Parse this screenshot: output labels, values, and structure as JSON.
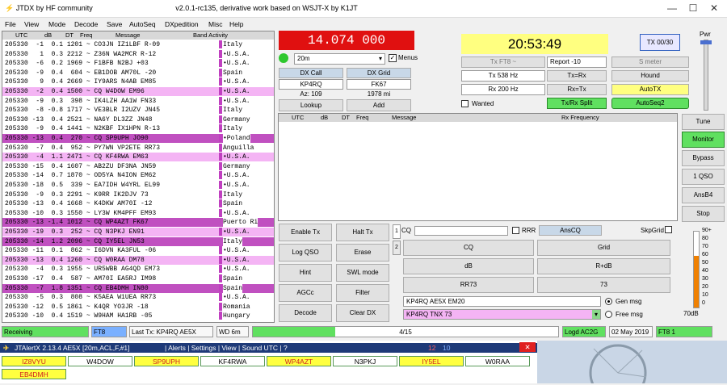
{
  "window": {
    "app_title": "JTDX  by HF community",
    "subtitle": "v2.0.1-rc135, derivative work based on WSJT-X by K1JT"
  },
  "menu": [
    "File",
    "View",
    "Mode",
    "Decode",
    "Save",
    "AutoSeq",
    "DXpedition",
    "Misc",
    "Help"
  ],
  "band_activity": {
    "headers": {
      "utc": "UTC",
      "db": "dB",
      "dt": "DT",
      "freq": "Freq",
      "message": "Message",
      "title": "Band Activity"
    },
    "rows": [
      {
        "text": "205330  -1  0.1 1201 ~ CO3JN IZ1LBF R-09",
        "country": "Italy",
        "bg": "#ffffff",
        "mark": true
      },
      {
        "text": "205330   1  0.3 2212 ~ Z36N WA2MCR R-12",
        "country": "•U.S.A.",
        "bg": "#ffffff",
        "mark": true
      },
      {
        "text": "205330  -6  0.2 1969 ~ F1BFB N2BJ +03",
        "country": "•U.S.A.",
        "bg": "#ffffff",
        "mark": true
      },
      {
        "text": "205330  -9  0.4  604 ~ EB1DOB AM70L -20",
        "country": "Spain",
        "bg": "#ffffff",
        "mark": true
      },
      {
        "text": "205330   9  0.4 2669 ~ IY9ARS N4AB EM85",
        "country": "•U.S.A.",
        "bg": "#ffffff",
        "mark": true
      },
      {
        "text": "205330  -2  0.4 1500 ~ CQ W4DOW EM96",
        "country": "•U.S.A.",
        "bg": "#f4b4f4",
        "mark": true
      },
      {
        "text": "205330  -9  0.3  398 ~ IK4LZH AA1W FN33",
        "country": "•U.S.A.",
        "bg": "#ffffff",
        "mark": true
      },
      {
        "text": "205330  -8 -0.8 1717 ~ VE3BLR I2UZV JN45",
        "country": "Italy",
        "bg": "#ffffff",
        "mark": true
      },
      {
        "text": "205330 -13  0.4 2521 ~ NA6Y DL3ZZ JN48",
        "country": "Germany",
        "bg": "#ffffff",
        "mark": true
      },
      {
        "text": "205330  -9  0.4 1441 ~ N2KBF IX1HPN R-13",
        "country": "Italy",
        "bg": "#ffffff",
        "mark": true
      },
      {
        "text": "205330 -13  0.4  270 ~ CQ SP9UPH JO90",
        "country": "•Poland",
        "bg": "#c050c0",
        "mark": true
      },
      {
        "text": "205330  -7  0.4  952 ~ PY7WN VP2ETE RR73",
        "country": "Anguilla",
        "bg": "#ffffff",
        "mark": true
      },
      {
        "text": "205330  -4  1.1 2471 ~ CQ KF4RWA EM63",
        "country": "•U.S.A.",
        "bg": "#f4b4f4",
        "mark": true
      },
      {
        "text": "205330 -15  0.4 1607 ~ AB2ZU DF3NA JN59",
        "country": "Germany",
        "bg": "#ffffff",
        "mark": true
      },
      {
        "text": "205330 -14  0.7 1870 ~ OD5YA N4ION EM62",
        "country": "•U.S.A.",
        "bg": "#ffffff",
        "mark": true
      },
      {
        "text": "205330 -18  0.5  339 ~ EA7IDH W4YRL EL99",
        "country": "•U.S.A.",
        "bg": "#ffffff",
        "mark": true
      },
      {
        "text": "205330  -9  0.3 2291 ~ K9RR IK2DJV 73",
        "country": "Italy",
        "bg": "#ffffff",
        "mark": true
      },
      {
        "text": "205330 -13  0.4 1668 ~ K4DKW AM70I -12",
        "country": "Spain",
        "bg": "#ffffff",
        "mark": true
      },
      {
        "text": "205330 -10  0.3 1550 ~ LY3W KM4PFF EM93",
        "country": "•U.S.A.",
        "bg": "#ffffff",
        "mark": true
      },
      {
        "text": "205330 -13 -1.4 1012 ~ CQ WP4AZT FK67",
        "country": "Puerto Ri",
        "bg": "#c050c0",
        "mark": false
      },
      {
        "text": "205330 -19  0.3  252 ~ CQ N3PKJ EN91",
        "country": "•U.S.A.",
        "bg": "#f4b4f4",
        "mark": true
      },
      {
        "text": "205330 -14  1.2 2096 ~ CQ IY5EL JN53",
        "country": "Italy",
        "bg": "#c050c0",
        "mark": false
      },
      {
        "text": "205330 -11  0.1  862 ~ I6DVN KA3FUL -06",
        "country": "•U.S.A.",
        "bg": "#ffffff",
        "mark": true
      },
      {
        "text": "205330 -13  0.4 1260 ~ CQ W0RAA DM78",
        "country": "•U.S.A.",
        "bg": "#f4b4f4",
        "mark": true
      },
      {
        "text": "205330  -4  0.3 1955 ~ UR5WBB AG4QD EM73",
        "country": "•U.S.A.",
        "bg": "#ffffff",
        "mark": true
      },
      {
        "text": "205330 -17  0.4  587 ~ AM70I EA5RJ IM98",
        "country": "Spain",
        "bg": "#ffffff",
        "mark": true
      },
      {
        "text": "205330  -7  1.8 1351 ~ CQ EB4DMH IN80",
        "country": "Spain",
        "bg": "#c050c0",
        "mark": true
      },
      {
        "text": "205330  -5  0.3  808 ~ K5AEA W1UEA RR73",
        "country": "•U.S.A.",
        "bg": "#ffffff",
        "mark": true
      },
      {
        "text": "205330 -12  0.5 1861 ~ K4QR YO3JR -18",
        "country": "Romania",
        "bg": "#ffffff",
        "mark": true
      },
      {
        "text": "205330 -10  0.4 1519 ~ W9HAM HA1RB -05",
        "country": "Hungary",
        "bg": "#ffffff",
        "mark": true
      }
    ]
  },
  "frequency": "14.074 000",
  "band": "20m",
  "menus_label": "Menus",
  "dx": {
    "call_label": "DX Call",
    "grid_label": "DX Grid",
    "call": "KP4RQ",
    "grid": "FK67",
    "az": "Az: 109",
    "distance": "1978 mi",
    "lookup": "Lookup",
    "add": "Add"
  },
  "clock": "20:53:49",
  "tx_counter": "TX 00/30",
  "pwr_label": "Pwr",
  "tx_controls": {
    "tx_mode": "Tx FT8 ~",
    "report": "Report -10",
    "s_meter": "S meter",
    "tx_freq": "Tx  538  Hz",
    "tx_eq_rx": "Tx=Rx",
    "hound": "Hound",
    "rx_freq": "Rx  200  Hz",
    "rx_eq_tx": "Rx=Tx",
    "autotx": "AutoTX",
    "wanted": "Wanted",
    "split": "Tx/Rx Split",
    "autoseq": "AutoSeq2"
  },
  "rx_panel": {
    "headers": {
      "utc": "UTC",
      "db": "dB",
      "dt": "DT",
      "freq": "Freq",
      "message": "Message",
      "title": "Rx Frequency"
    }
  },
  "right_buttons": [
    "Tune",
    "Monitor",
    "Bypass",
    "1 QSO",
    "AnsB4",
    "Stop"
  ],
  "left_buttons": [
    [
      "Enable Tx",
      "Halt Tx"
    ],
    [
      "Log QSO",
      "Erase"
    ],
    [
      "Hint",
      "SWL mode"
    ],
    [
      "AGCc",
      "Filter"
    ],
    [
      "Decode",
      "Clear DX"
    ]
  ],
  "tabs": [
    "1",
    "2"
  ],
  "msg_area": {
    "cq_label": "CQ",
    "rrr_label": "RRR",
    "anscq": "AnsCQ",
    "skpgrid": "SkpGrid",
    "cq": "CQ",
    "grid": "Grid",
    "db": "dB",
    "rdb": "R+dB",
    "rr73": "RR73",
    "seventythree": "73",
    "gen_field": "KP4RQ AE5X EM20",
    "gen_msg": "Gen msg",
    "free_field": "KP4RQ TNX 73",
    "free_msg": "Free msg"
  },
  "meter": {
    "ticks": [
      "90+",
      "80",
      "70",
      "60",
      "50",
      "40",
      "30",
      "20",
      "10",
      "0"
    ],
    "db": "70dB",
    "level": 0.68
  },
  "status": {
    "receiving": "Receiving",
    "mode": "FT8",
    "last_tx": "Last Tx: KP4RQ AE5X EM20",
    "wd": "WD 6m",
    "progress": "4/15",
    "progress_frac": 0.27,
    "logd": "Logd AC2G",
    "date": "02 May 2019",
    "ft8": "FT8  1"
  },
  "alert": {
    "title": "JTAlertX 2.13.4 AE5X [20m,ACL,F,#1]",
    "menu": "| Alerts | Settings | View | Sound UTC | ?",
    "count1": "12",
    "count2": "10",
    "row1": [
      {
        "call": "IZ8VYU",
        "bg": "#ffff40"
      },
      {
        "call": "W4DOW",
        "bg": "#ffffff"
      },
      {
        "call": "SP9UPH",
        "bg": "#ffff40"
      },
      {
        "call": "KF4RWA",
        "bg": "#ffffff"
      },
      {
        "call": "WP4AZT",
        "bg": "#ffff40"
      },
      {
        "call": "N3PKJ",
        "bg": "#ffffff"
      },
      {
        "call": "IY5EL",
        "bg": "#ffff40"
      },
      {
        "call": "W0RAA",
        "bg": "#ffffff"
      }
    ],
    "row2": [
      {
        "call": "EB4DMH",
        "bg": "#ffff40"
      }
    ]
  }
}
